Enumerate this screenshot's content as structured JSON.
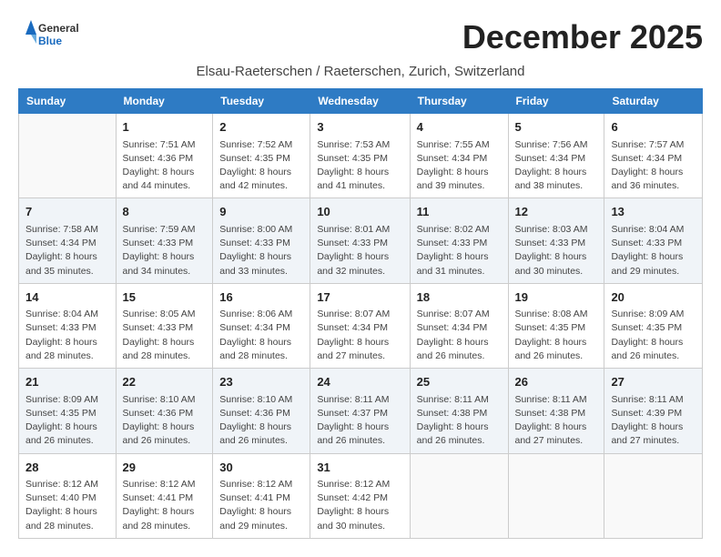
{
  "logo": {
    "general": "General",
    "blue": "Blue"
  },
  "title": "December 2025",
  "location": "Elsau-Raeterschen / Raeterschen, Zurich, Switzerland",
  "weekdays": [
    "Sunday",
    "Monday",
    "Tuesday",
    "Wednesday",
    "Thursday",
    "Friday",
    "Saturday"
  ],
  "weeks": [
    [
      {
        "day": "",
        "sunrise": "",
        "sunset": "",
        "daylight": ""
      },
      {
        "day": "1",
        "sunrise": "Sunrise: 7:51 AM",
        "sunset": "Sunset: 4:36 PM",
        "daylight": "Daylight: 8 hours and 44 minutes."
      },
      {
        "day": "2",
        "sunrise": "Sunrise: 7:52 AM",
        "sunset": "Sunset: 4:35 PM",
        "daylight": "Daylight: 8 hours and 42 minutes."
      },
      {
        "day": "3",
        "sunrise": "Sunrise: 7:53 AM",
        "sunset": "Sunset: 4:35 PM",
        "daylight": "Daylight: 8 hours and 41 minutes."
      },
      {
        "day": "4",
        "sunrise": "Sunrise: 7:55 AM",
        "sunset": "Sunset: 4:34 PM",
        "daylight": "Daylight: 8 hours and 39 minutes."
      },
      {
        "day": "5",
        "sunrise": "Sunrise: 7:56 AM",
        "sunset": "Sunset: 4:34 PM",
        "daylight": "Daylight: 8 hours and 38 minutes."
      },
      {
        "day": "6",
        "sunrise": "Sunrise: 7:57 AM",
        "sunset": "Sunset: 4:34 PM",
        "daylight": "Daylight: 8 hours and 36 minutes."
      }
    ],
    [
      {
        "day": "7",
        "sunrise": "Sunrise: 7:58 AM",
        "sunset": "Sunset: 4:34 PM",
        "daylight": "Daylight: 8 hours and 35 minutes."
      },
      {
        "day": "8",
        "sunrise": "Sunrise: 7:59 AM",
        "sunset": "Sunset: 4:33 PM",
        "daylight": "Daylight: 8 hours and 34 minutes."
      },
      {
        "day": "9",
        "sunrise": "Sunrise: 8:00 AM",
        "sunset": "Sunset: 4:33 PM",
        "daylight": "Daylight: 8 hours and 33 minutes."
      },
      {
        "day": "10",
        "sunrise": "Sunrise: 8:01 AM",
        "sunset": "Sunset: 4:33 PM",
        "daylight": "Daylight: 8 hours and 32 minutes."
      },
      {
        "day": "11",
        "sunrise": "Sunrise: 8:02 AM",
        "sunset": "Sunset: 4:33 PM",
        "daylight": "Daylight: 8 hours and 31 minutes."
      },
      {
        "day": "12",
        "sunrise": "Sunrise: 8:03 AM",
        "sunset": "Sunset: 4:33 PM",
        "daylight": "Daylight: 8 hours and 30 minutes."
      },
      {
        "day": "13",
        "sunrise": "Sunrise: 8:04 AM",
        "sunset": "Sunset: 4:33 PM",
        "daylight": "Daylight: 8 hours and 29 minutes."
      }
    ],
    [
      {
        "day": "14",
        "sunrise": "Sunrise: 8:04 AM",
        "sunset": "Sunset: 4:33 PM",
        "daylight": "Daylight: 8 hours and 28 minutes."
      },
      {
        "day": "15",
        "sunrise": "Sunrise: 8:05 AM",
        "sunset": "Sunset: 4:33 PM",
        "daylight": "Daylight: 8 hours and 28 minutes."
      },
      {
        "day": "16",
        "sunrise": "Sunrise: 8:06 AM",
        "sunset": "Sunset: 4:34 PM",
        "daylight": "Daylight: 8 hours and 28 minutes."
      },
      {
        "day": "17",
        "sunrise": "Sunrise: 8:07 AM",
        "sunset": "Sunset: 4:34 PM",
        "daylight": "Daylight: 8 hours and 27 minutes."
      },
      {
        "day": "18",
        "sunrise": "Sunrise: 8:07 AM",
        "sunset": "Sunset: 4:34 PM",
        "daylight": "Daylight: 8 hours and 26 minutes."
      },
      {
        "day": "19",
        "sunrise": "Sunrise: 8:08 AM",
        "sunset": "Sunset: 4:35 PM",
        "daylight": "Daylight: 8 hours and 26 minutes."
      },
      {
        "day": "20",
        "sunrise": "Sunrise: 8:09 AM",
        "sunset": "Sunset: 4:35 PM",
        "daylight": "Daylight: 8 hours and 26 minutes."
      }
    ],
    [
      {
        "day": "21",
        "sunrise": "Sunrise: 8:09 AM",
        "sunset": "Sunset: 4:35 PM",
        "daylight": "Daylight: 8 hours and 26 minutes."
      },
      {
        "day": "22",
        "sunrise": "Sunrise: 8:10 AM",
        "sunset": "Sunset: 4:36 PM",
        "daylight": "Daylight: 8 hours and 26 minutes."
      },
      {
        "day": "23",
        "sunrise": "Sunrise: 8:10 AM",
        "sunset": "Sunset: 4:36 PM",
        "daylight": "Daylight: 8 hours and 26 minutes."
      },
      {
        "day": "24",
        "sunrise": "Sunrise: 8:11 AM",
        "sunset": "Sunset: 4:37 PM",
        "daylight": "Daylight: 8 hours and 26 minutes."
      },
      {
        "day": "25",
        "sunrise": "Sunrise: 8:11 AM",
        "sunset": "Sunset: 4:38 PM",
        "daylight": "Daylight: 8 hours and 26 minutes."
      },
      {
        "day": "26",
        "sunrise": "Sunrise: 8:11 AM",
        "sunset": "Sunset: 4:38 PM",
        "daylight": "Daylight: 8 hours and 27 minutes."
      },
      {
        "day": "27",
        "sunrise": "Sunrise: 8:11 AM",
        "sunset": "Sunset: 4:39 PM",
        "daylight": "Daylight: 8 hours and 27 minutes."
      }
    ],
    [
      {
        "day": "28",
        "sunrise": "Sunrise: 8:12 AM",
        "sunset": "Sunset: 4:40 PM",
        "daylight": "Daylight: 8 hours and 28 minutes."
      },
      {
        "day": "29",
        "sunrise": "Sunrise: 8:12 AM",
        "sunset": "Sunset: 4:41 PM",
        "daylight": "Daylight: 8 hours and 28 minutes."
      },
      {
        "day": "30",
        "sunrise": "Sunrise: 8:12 AM",
        "sunset": "Sunset: 4:41 PM",
        "daylight": "Daylight: 8 hours and 29 minutes."
      },
      {
        "day": "31",
        "sunrise": "Sunrise: 8:12 AM",
        "sunset": "Sunset: 4:42 PM",
        "daylight": "Daylight: 8 hours and 30 minutes."
      },
      {
        "day": "",
        "sunrise": "",
        "sunset": "",
        "daylight": ""
      },
      {
        "day": "",
        "sunrise": "",
        "sunset": "",
        "daylight": ""
      },
      {
        "day": "",
        "sunrise": "",
        "sunset": "",
        "daylight": ""
      }
    ]
  ],
  "rowShading": [
    false,
    true,
    false,
    true,
    false
  ]
}
